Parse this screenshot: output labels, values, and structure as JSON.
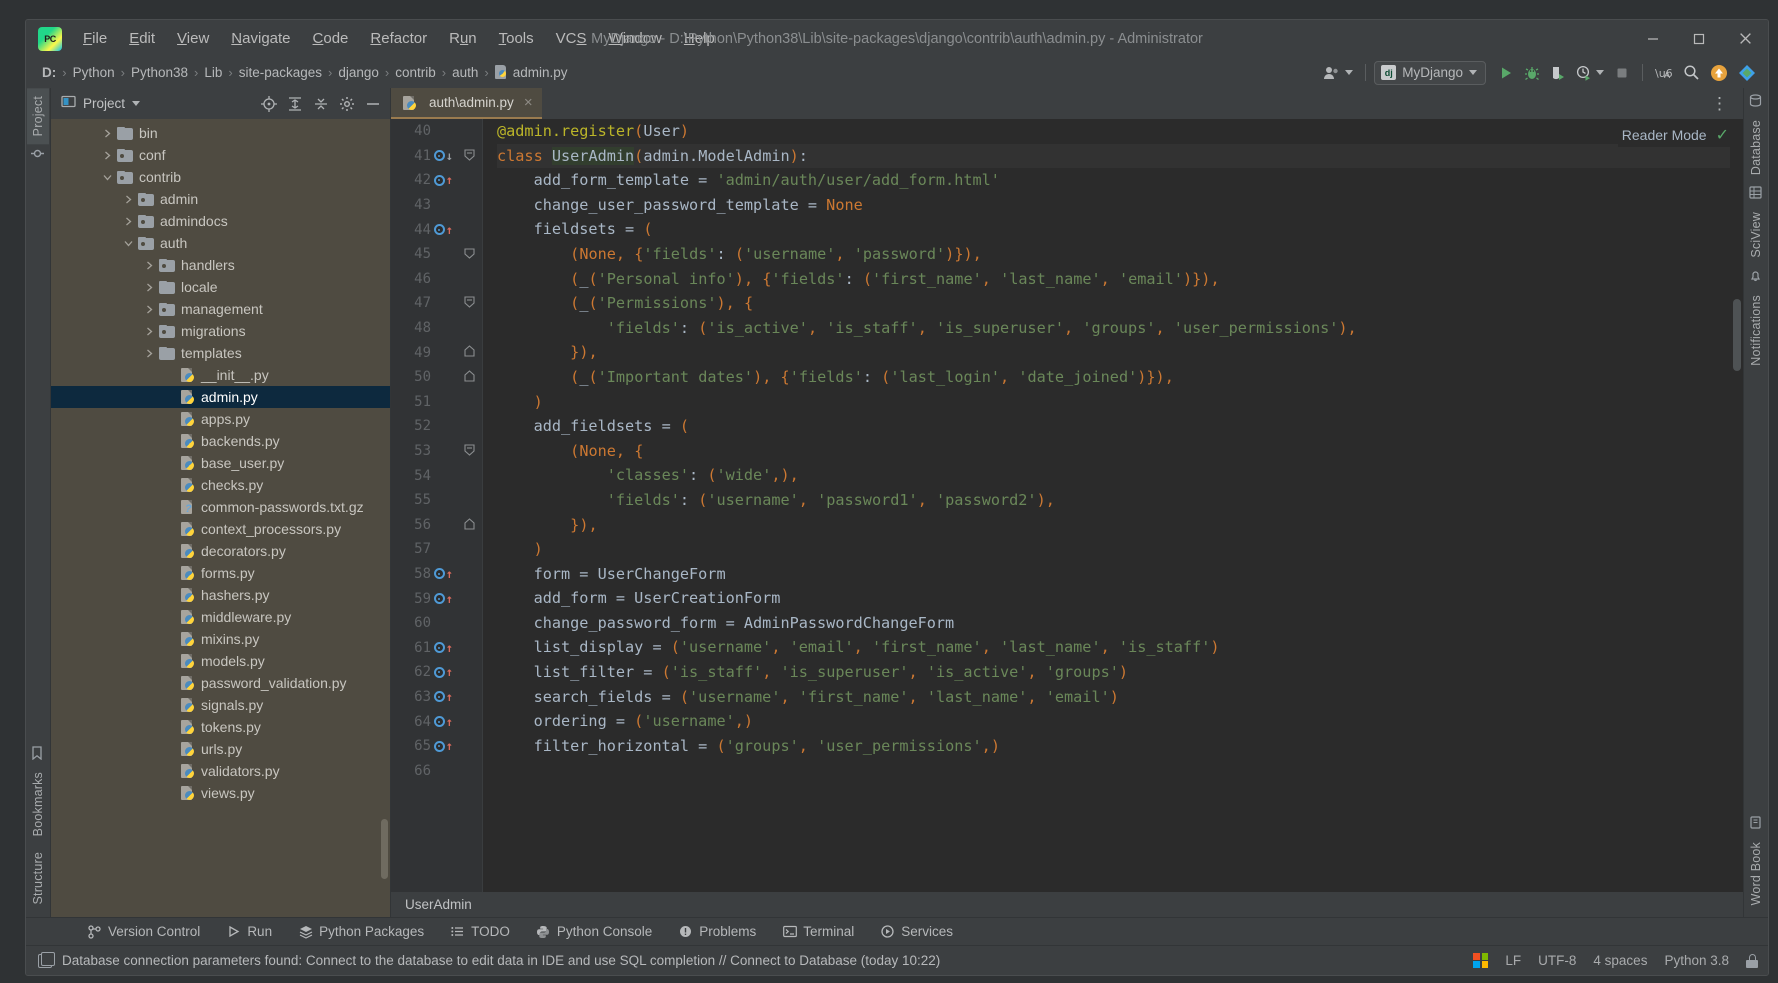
{
  "window": {
    "title": "MyDjango - D:\\Python\\Python38\\Lib\\site-packages\\django\\contrib\\auth\\admin.py - Administrator",
    "logo_text": "PC",
    "controls": {
      "minimize": "minimize-button",
      "maximize": "maximize-button",
      "close": "close-button"
    }
  },
  "menu": [
    {
      "label": "File",
      "mnemonic": "F"
    },
    {
      "label": "Edit",
      "mnemonic": "E"
    },
    {
      "label": "View",
      "mnemonic": "V"
    },
    {
      "label": "Navigate",
      "mnemonic": "N"
    },
    {
      "label": "Code",
      "mnemonic": "C"
    },
    {
      "label": "Refactor",
      "mnemonic": "R"
    },
    {
      "label": "Run",
      "mnemonic": "u"
    },
    {
      "label": "Tools",
      "mnemonic": "T"
    },
    {
      "label": "VCS",
      "mnemonic": "S"
    },
    {
      "label": "Window",
      "mnemonic": "W"
    },
    {
      "label": "Help",
      "mnemonic": "H"
    }
  ],
  "breadcrumb": {
    "items": [
      "D:",
      "Python",
      "Python38",
      "Lib",
      "site-packages",
      "django",
      "contrib",
      "auth",
      "admin.py"
    ],
    "separator": "›"
  },
  "toolbar": {
    "run_config": {
      "label": "MyDjango",
      "icon_text": "dj"
    },
    "buttons": [
      {
        "name": "run-button",
        "glyph": "▶"
      },
      {
        "name": "debug-button",
        "glyph": "bug"
      },
      {
        "name": "coverage-button",
        "glyph": "shield"
      },
      {
        "name": "profile-button",
        "glyph": "clock"
      },
      {
        "name": "stop-button",
        "glyph": "■"
      },
      {
        "name": "translate-button",
        "glyph": "文A"
      },
      {
        "name": "search-everywhere-button",
        "glyph": "search"
      },
      {
        "name": "update-button",
        "glyph": "↑"
      },
      {
        "name": "ide-assistant-button",
        "glyph": "diamond"
      }
    ],
    "account_label": "account"
  },
  "project_panel": {
    "title": "Project",
    "header_icons": [
      "locate-icon",
      "expand-all-icon",
      "collapse-all-icon",
      "settings-gear-icon",
      "hide-panel-icon"
    ],
    "tree": [
      {
        "label": "bin",
        "indent": 2,
        "type": "folder",
        "state": "collapsed"
      },
      {
        "label": "conf",
        "indent": 2,
        "type": "package",
        "state": "collapsed"
      },
      {
        "label": "contrib",
        "indent": 2,
        "type": "package",
        "state": "expanded"
      },
      {
        "label": "admin",
        "indent": 3,
        "type": "package",
        "state": "collapsed"
      },
      {
        "label": "admindocs",
        "indent": 3,
        "type": "package",
        "state": "collapsed"
      },
      {
        "label": "auth",
        "indent": 3,
        "type": "package",
        "state": "expanded"
      },
      {
        "label": "handlers",
        "indent": 4,
        "type": "package",
        "state": "collapsed"
      },
      {
        "label": "locale",
        "indent": 4,
        "type": "folder",
        "state": "collapsed"
      },
      {
        "label": "management",
        "indent": 4,
        "type": "package",
        "state": "collapsed"
      },
      {
        "label": "migrations",
        "indent": 4,
        "type": "package",
        "state": "collapsed"
      },
      {
        "label": "templates",
        "indent": 4,
        "type": "folder",
        "state": "collapsed"
      },
      {
        "label": "__init__.py",
        "indent": 5,
        "type": "py",
        "state": "leaf"
      },
      {
        "label": "admin.py",
        "indent": 5,
        "type": "py",
        "state": "leaf",
        "selected": true
      },
      {
        "label": "apps.py",
        "indent": 5,
        "type": "py",
        "state": "leaf"
      },
      {
        "label": "backends.py",
        "indent": 5,
        "type": "py",
        "state": "leaf"
      },
      {
        "label": "base_user.py",
        "indent": 5,
        "type": "py",
        "state": "leaf"
      },
      {
        "label": "checks.py",
        "indent": 5,
        "type": "py",
        "state": "leaf"
      },
      {
        "label": "common-passwords.txt.gz",
        "indent": 5,
        "type": "unknown",
        "state": "leaf"
      },
      {
        "label": "context_processors.py",
        "indent": 5,
        "type": "py",
        "state": "leaf"
      },
      {
        "label": "decorators.py",
        "indent": 5,
        "type": "py",
        "state": "leaf"
      },
      {
        "label": "forms.py",
        "indent": 5,
        "type": "py",
        "state": "leaf"
      },
      {
        "label": "hashers.py",
        "indent": 5,
        "type": "py",
        "state": "leaf"
      },
      {
        "label": "middleware.py",
        "indent": 5,
        "type": "py",
        "state": "leaf"
      },
      {
        "label": "mixins.py",
        "indent": 5,
        "type": "py",
        "state": "leaf"
      },
      {
        "label": "models.py",
        "indent": 5,
        "type": "py",
        "state": "leaf"
      },
      {
        "label": "password_validation.py",
        "indent": 5,
        "type": "py",
        "state": "leaf"
      },
      {
        "label": "signals.py",
        "indent": 5,
        "type": "py",
        "state": "leaf"
      },
      {
        "label": "tokens.py",
        "indent": 5,
        "type": "py",
        "state": "leaf"
      },
      {
        "label": "urls.py",
        "indent": 5,
        "type": "py",
        "state": "leaf"
      },
      {
        "label": "validators.py",
        "indent": 5,
        "type": "py",
        "state": "leaf"
      },
      {
        "label": "views.py",
        "indent": 5,
        "type": "py",
        "state": "leaf"
      }
    ]
  },
  "left_rail": {
    "top": [
      "Project"
    ],
    "bottom": [
      "Bookmarks",
      "Structure"
    ]
  },
  "right_rail": [
    "Database",
    "SciView",
    "Notifications",
    "Word Book"
  ],
  "editor": {
    "tab": {
      "label": "auth\\admin.py",
      "close_glyph": "×"
    },
    "reader_mode": {
      "label": "Reader Mode",
      "check_glyph": "✓"
    },
    "options_glyph": "⋮",
    "status_breadcrumb": "UserAdmin",
    "first_line_number": 40,
    "lines": [
      {
        "n": 40,
        "marker": "",
        "fold": "",
        "code": "@admin.register(User)"
      },
      {
        "n": 41,
        "marker": "impl-down",
        "fold": "start",
        "code": "class UserAdmin(admin.ModelAdmin):"
      },
      {
        "n": 42,
        "marker": "impl-up",
        "fold": "",
        "code": "    add_form_template = 'admin/auth/user/add_form.html'"
      },
      {
        "n": 43,
        "marker": "",
        "fold": "",
        "code": "    change_user_password_template = None"
      },
      {
        "n": 44,
        "marker": "impl-up",
        "fold": "",
        "code": "    fieldsets = ("
      },
      {
        "n": 45,
        "marker": "",
        "fold": "end",
        "code": "        (None, {'fields': ('username', 'password')}),"
      },
      {
        "n": 46,
        "marker": "",
        "fold": "",
        "code": "        (_('Personal info'), {'fields': ('first_name', 'last_name', 'email')}),"
      },
      {
        "n": 47,
        "marker": "",
        "fold": "start",
        "code": "        (_('Permissions'), {"
      },
      {
        "n": 48,
        "marker": "",
        "fold": "",
        "code": "            'fields': ('is_active', 'is_staff', 'is_superuser', 'groups', 'user_permissions'),"
      },
      {
        "n": 49,
        "marker": "",
        "fold": "endup",
        "code": "        }),"
      },
      {
        "n": 50,
        "marker": "",
        "fold": "endup",
        "code": "        (_('Important dates'), {'fields': ('last_login', 'date_joined')}),"
      },
      {
        "n": 51,
        "marker": "",
        "fold": "",
        "code": "    )"
      },
      {
        "n": 52,
        "marker": "",
        "fold": "",
        "code": "    add_fieldsets = ("
      },
      {
        "n": 53,
        "marker": "",
        "fold": "start",
        "code": "        (None, {"
      },
      {
        "n": 54,
        "marker": "",
        "fold": "",
        "code": "            'classes': ('wide',),"
      },
      {
        "n": 55,
        "marker": "",
        "fold": "",
        "code": "            'fields': ('username', 'password1', 'password2'),"
      },
      {
        "n": 56,
        "marker": "",
        "fold": "endup",
        "code": "        }),"
      },
      {
        "n": 57,
        "marker": "",
        "fold": "",
        "code": "    )"
      },
      {
        "n": 58,
        "marker": "impl-up",
        "fold": "",
        "code": "    form = UserChangeForm"
      },
      {
        "n": 59,
        "marker": "impl-up",
        "fold": "",
        "code": "    add_form = UserCreationForm"
      },
      {
        "n": 60,
        "marker": "",
        "fold": "",
        "code": "    change_password_form = AdminPasswordChangeForm"
      },
      {
        "n": 61,
        "marker": "impl-up",
        "fold": "",
        "code": "    list_display = ('username', 'email', 'first_name', 'last_name', 'is_staff')"
      },
      {
        "n": 62,
        "marker": "impl-up",
        "fold": "",
        "code": "    list_filter = ('is_staff', 'is_superuser', 'is_active', 'groups')"
      },
      {
        "n": 63,
        "marker": "impl-up",
        "fold": "",
        "code": "    search_fields = ('username', 'first_name', 'last_name', 'email')"
      },
      {
        "n": 64,
        "marker": "impl-up",
        "fold": "",
        "code": "    ordering = ('username',)"
      },
      {
        "n": 65,
        "marker": "impl-up",
        "fold": "",
        "code": "    filter_horizontal = ('groups', 'user_permissions',)"
      },
      {
        "n": 66,
        "marker": "",
        "fold": "",
        "code": ""
      }
    ]
  },
  "tool_windows": [
    {
      "label": "Version Control",
      "icon": "branch-icon"
    },
    {
      "label": "Run",
      "icon": "play-icon"
    },
    {
      "label": "Python Packages",
      "icon": "layers-icon"
    },
    {
      "label": "TODO",
      "icon": "list-icon"
    },
    {
      "label": "Python Console",
      "icon": "python-icon"
    },
    {
      "label": "Problems",
      "icon": "warning-icon"
    },
    {
      "label": "Terminal",
      "icon": "terminal-icon"
    },
    {
      "label": "Services",
      "icon": "services-icon"
    }
  ],
  "status_bar": {
    "message": "Database connection parameters found: Connect to the database to edit data in IDE and use SQL completion // Connect to Database (today 10:22)",
    "line_separator": "LF",
    "encoding": "UTF-8",
    "indent": "4 spaces",
    "interpreter": "Python 3.8",
    "os_icon": "windows-logo-icon",
    "lock_icon": "lock-icon"
  },
  "colors": {
    "accent_green": "#59a869",
    "selection_blue": "#0d293e",
    "editor_bg": "#2b2b2b",
    "panel_bg": "#3c3f41",
    "project_bg": "#4f4b41",
    "string": "#6a8759",
    "keyword": "#cc7832",
    "decorator": "#bbb529"
  }
}
